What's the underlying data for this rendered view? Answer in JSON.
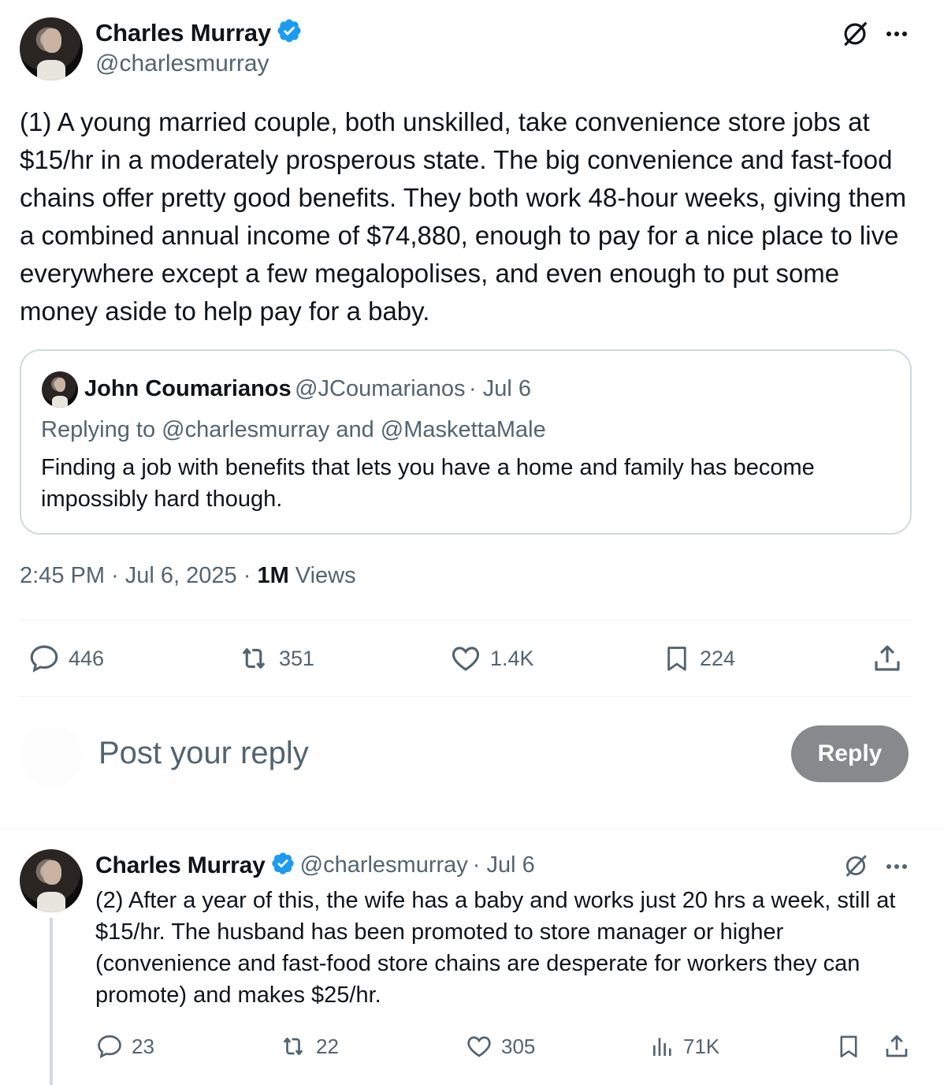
{
  "main_tweet": {
    "author_name": "Charles Murray",
    "author_handle": "@charlesmurray",
    "text": "(1) A young married couple, both unskilled, take convenience store jobs at $15/hr in a moderately prosperous state. The big convenience and fast-food chains offer pretty good benefits. They both  work 48-hour weeks, giving them a combined annual income of $74,880, enough to pay for a nice place to live everywhere except a few megalopolises, and even enough to put some money aside to help pay for a baby.",
    "quoted": {
      "author_name": "John Coumarianos",
      "author_handle": "@JCoumarianos",
      "date": "· Jul 6",
      "replying_to": "Replying to @charlesmurray and @MaskettaMale",
      "text": "Finding a job with benefits that lets you have a home and family has become impossibly hard though."
    },
    "timestamp": "2:45 PM · Jul 6, 2025 · ",
    "views_count": "1M",
    "views_label": " Views",
    "stats": {
      "replies": "446",
      "reposts": "351",
      "likes": "1.4K",
      "bookmarks": "224"
    }
  },
  "reply_box": {
    "placeholder": "Post your reply",
    "button_label": "Reply"
  },
  "second_tweet": {
    "author_name": "Charles Murray",
    "author_handle": "@charlesmurray",
    "date": "· Jul 6",
    "text": "(2) After a year of this, the wife has a baby and works just 20 hrs a week, still at $15/hr. The husband has been promoted to store manager or higher (convenience and fast-food store chains are desperate for workers they can promote) and makes $25/hr.",
    "stats": {
      "replies": "23",
      "reposts": "22",
      "likes": "305",
      "views": "71K"
    }
  },
  "colors": {
    "verified_blue": "#1d9bf0",
    "secondary_text": "#536471",
    "reply_button": "#87898c"
  },
  "icons": [
    "verified-badge-icon",
    "grok-icon",
    "more-icon",
    "reply-icon",
    "repost-icon",
    "like-icon",
    "bookmark-icon",
    "share-icon",
    "views-icon"
  ]
}
